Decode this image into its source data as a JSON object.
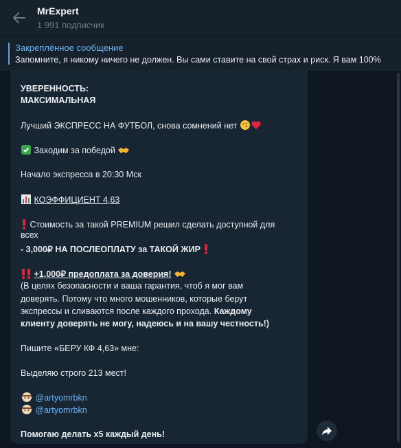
{
  "header": {
    "title": "MrExpert",
    "subscribers": "1 991 подписчик"
  },
  "pinned": {
    "title": "Закреплённое сообщение",
    "text": "Запомните, я никому ничего не должен. Вы сами ставите на свой страх и риск. Я вам 100%"
  },
  "message": {
    "confidence_label": "УВЕРЕННОСТЬ:",
    "confidence_value": "МАКСИМАЛЬНАЯ",
    "best_express": "Лучший ЭКСПРЕСС НА ФУТБОЛ, снова сомнений нет",
    "going_for_win": "Заходим за победой",
    "start_time": "Начало экспресса в 20:30 Мск",
    "coefficient": "КОЭФФИЦИЕНТ 4,63",
    "cost_line1": "Стоимость за такой PREMIUM решил сделать доступной для",
    "cost_line2": "всех",
    "postpay": "- 3,000₽ НА ПОСЛЕОПЛАТУ за ТАКОЙ ЖИР",
    "prepay": "+1,000₽ предоплата за доверия!",
    "explain1": "(В целях безопасности и ваша гарантия, чтоб я мог вам",
    "explain2": "доверять. Потому что много мошенников, которые берут",
    "explain3": "экспрессы и сливаются после каждого прохода.",
    "explain3_bold": "Каждому",
    "explain4": "клиенту доверять не могу, надеюсь и на вашу честность!)",
    "write": "Пишите «БЕРУ КФ 4,63» мне:",
    "seats": "Выделяю строго 213 мест!",
    "contact1": "@artyomrbkn",
    "contact2": "@artyomrbkn",
    "closing": "Помогаю делать x5 каждый день!"
  },
  "icons": {
    "back": "back-arrow-icon",
    "share": "share-arrow-icon"
  },
  "colors": {
    "background": "#0e1621",
    "header": "#17212b",
    "bubble": "#182533",
    "accent": "#6ab3f3"
  }
}
